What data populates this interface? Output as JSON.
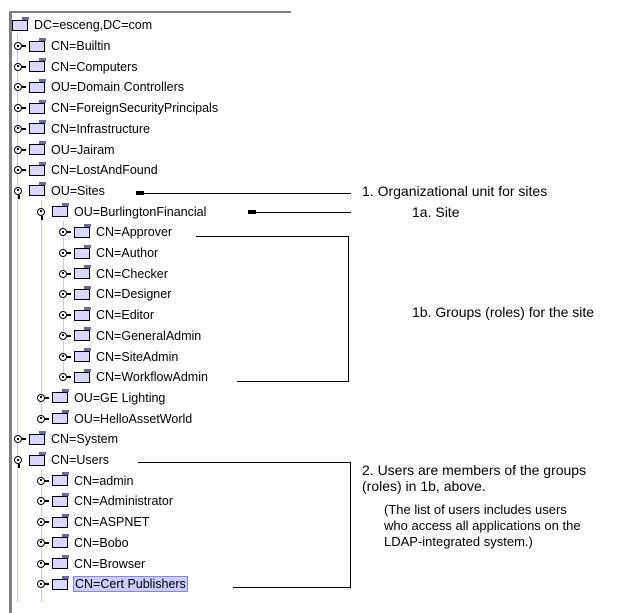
{
  "tree": {
    "root": "DC=esceng,DC=com",
    "nodes": [
      {
        "label": "CN=Builtin",
        "level": 1,
        "expanded": false
      },
      {
        "label": "CN=Computers",
        "level": 1,
        "expanded": false
      },
      {
        "label": "OU=Domain Controllers",
        "level": 1,
        "expanded": false
      },
      {
        "label": "CN=ForeignSecurityPrincipals",
        "level": 1,
        "expanded": false
      },
      {
        "label": "CN=Infrastructure",
        "level": 1,
        "expanded": false
      },
      {
        "label": "OU=Jairam",
        "level": 1,
        "expanded": false
      },
      {
        "label": "CN=LostAndFound",
        "level": 1,
        "expanded": false
      },
      {
        "label": "OU=Sites",
        "level": 1,
        "expanded": true
      },
      {
        "label": "OU=BurlingtonFinancial",
        "level": 2,
        "expanded": true
      },
      {
        "label": "CN=Approver",
        "level": 3,
        "expanded": false
      },
      {
        "label": "CN=Author",
        "level": 3,
        "expanded": false
      },
      {
        "label": "CN=Checker",
        "level": 3,
        "expanded": false
      },
      {
        "label": "CN=Designer",
        "level": 3,
        "expanded": false
      },
      {
        "label": "CN=Editor",
        "level": 3,
        "expanded": false
      },
      {
        "label": "CN=GeneralAdmin",
        "level": 3,
        "expanded": false
      },
      {
        "label": "CN=SiteAdmin",
        "level": 3,
        "expanded": false
      },
      {
        "label": "CN=WorkflowAdmin",
        "level": 3,
        "expanded": false
      },
      {
        "label": "OU=GE Lighting",
        "level": 2,
        "expanded": false
      },
      {
        "label": "OU=HelloAssetWorld",
        "level": 2,
        "expanded": false
      },
      {
        "label": "CN=System",
        "level": 1,
        "expanded": false
      },
      {
        "label": "CN=Users",
        "level": 1,
        "expanded": true
      },
      {
        "label": "CN=admin",
        "level": 2,
        "expanded": false
      },
      {
        "label": "CN=Administrator",
        "level": 2,
        "expanded": false
      },
      {
        "label": "CN=ASPNET",
        "level": 2,
        "expanded": false
      },
      {
        "label": "CN=Bobo",
        "level": 2,
        "expanded": false
      },
      {
        "label": "CN=Browser",
        "level": 2,
        "expanded": false
      },
      {
        "label": "CN=Cert Publishers",
        "level": 2,
        "expanded": false,
        "selected": true
      }
    ]
  },
  "annotations": {
    "a1": "1. Organizational unit for sites",
    "a1a": "1a. Site",
    "a1b": "1b. Groups (roles) for the site",
    "a2": "2.  Users are members of the groups (roles) in 1b, above.",
    "a2note": "(The list of users includes users who access all applications on the LDAP-integrated system.)"
  }
}
